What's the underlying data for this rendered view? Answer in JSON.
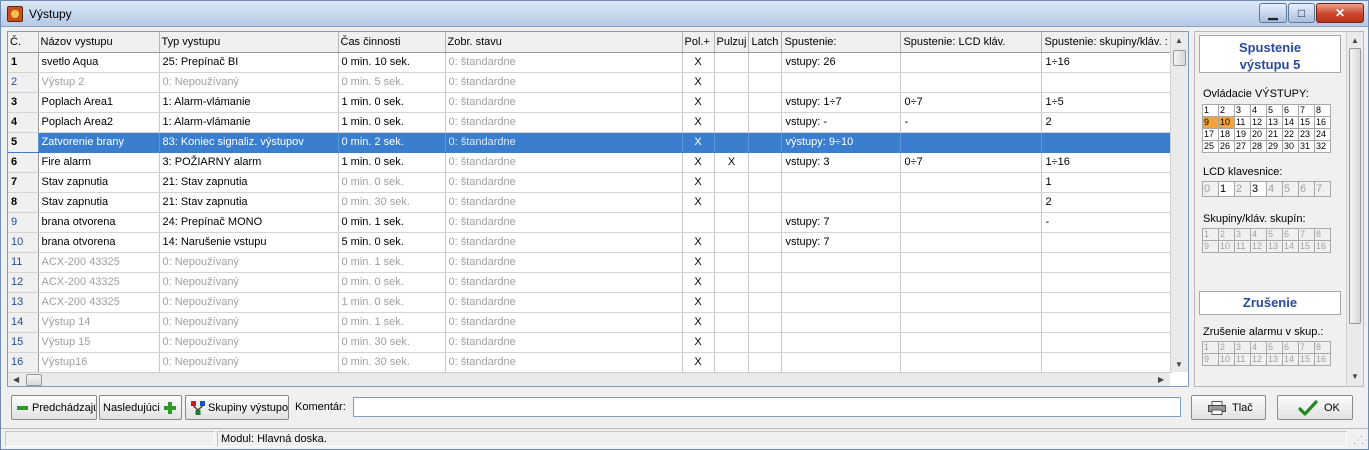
{
  "window": {
    "title": "Výstupy",
    "min_glyph": "▁",
    "max_glyph": "□",
    "close_glyph": "✕"
  },
  "table": {
    "columns": [
      "Č.",
      "Názov vystupu",
      "Typ vystupu",
      "Čas činnosti",
      "Zobr. stavu",
      "Pol.+",
      "Pulzuj",
      "Latch",
      "Spustenie:",
      "Spustenie: LCD kláv.",
      "Spustenie: skupiny/kláv. :"
    ],
    "rows": [
      {
        "num": "1",
        "name": "svetlo Aqua",
        "type": "25: Prepínač BI",
        "time": "0  min. 10  sek.",
        "state": "0: štandardne",
        "pol": "X",
        "pulz": "",
        "latch": "",
        "spust": "vstupy: 26",
        "lcd": "",
        "skup": "1÷16"
      },
      {
        "num": "2",
        "name": "Výstup   2",
        "type": "0: Nepoužívaný",
        "time": "0  min. 5  sek.",
        "state": "0: štandardne",
        "pol": "X",
        "pulz": "",
        "latch": "",
        "spust": "",
        "lcd": "",
        "skup": ""
      },
      {
        "num": "3",
        "name": "Poplach Area1",
        "type": "1: Alarm-vlámanie",
        "time": "1  min. 0  sek.",
        "state": "0: štandardne",
        "pol": "X",
        "pulz": "",
        "latch": "",
        "spust": "vstupy: 1÷7",
        "lcd": "0÷7",
        "skup": "1÷5"
      },
      {
        "num": "4",
        "name": "Poplach Area2",
        "type": "1: Alarm-vlámanie",
        "time": "1  min. 0  sek.",
        "state": "0: štandardne",
        "pol": "X",
        "pulz": "",
        "latch": "",
        "spust": "vstupy: -",
        "lcd": "-",
        "skup": "2"
      },
      {
        "num": "5",
        "name": "Zatvorenie brany",
        "type": "83: Koniec signaliz. výstupov",
        "time": "0  min. 2  sek.",
        "state": "0: štandardne",
        "pol": "X",
        "pulz": "",
        "latch": "",
        "spust": "výstupy: 9÷10",
        "lcd": "",
        "skup": ""
      },
      {
        "num": "6",
        "name": "Fire alarm",
        "type": "3: POŽIARNY alarm",
        "time": "1  min. 0  sek.",
        "state": "0: štandardne",
        "pol": "X",
        "pulz": "X",
        "latch": "",
        "spust": "vstupy: 3",
        "lcd": "0÷7",
        "skup": "1÷16"
      },
      {
        "num": "7",
        "name": "Stav zapnutia",
        "type": "21: Stav zapnutia",
        "time": "0  min. 0  sek.",
        "state": "0: štandardne",
        "pol": "X",
        "pulz": "",
        "latch": "",
        "spust": "",
        "lcd": "",
        "skup": "1"
      },
      {
        "num": "8",
        "name": "Stav zapnutia",
        "type": "21: Stav zapnutia",
        "time": "0  min. 30  sek.",
        "state": "0: štandardne",
        "pol": "X",
        "pulz": "",
        "latch": "",
        "spust": "",
        "lcd": "",
        "skup": "2"
      },
      {
        "num": "9",
        "name": "brana otvorena",
        "type": "24: Prepínač MONO",
        "time": "0  min. 1  sek.",
        "state": "0: štandardne",
        "pol": "",
        "pulz": "",
        "latch": "",
        "spust": "vstupy: 7",
        "lcd": "",
        "skup": "-"
      },
      {
        "num": "10",
        "name": "brana otvorena",
        "type": "14: Narušenie vstupu",
        "time": "5  min. 0  sek.",
        "state": "0: štandardne",
        "pol": "X",
        "pulz": "",
        "latch": "",
        "spust": "vstupy: 7",
        "lcd": "",
        "skup": ""
      },
      {
        "num": "11",
        "name": "ACX-200  43325",
        "type": "0: Nepoužívaný",
        "time": "0  min. 1  sek.",
        "state": "0: štandardne",
        "pol": "X",
        "pulz": "",
        "latch": "",
        "spust": "",
        "lcd": "",
        "skup": ""
      },
      {
        "num": "12",
        "name": "ACX-200  43325",
        "type": "0: Nepoužívaný",
        "time": "0  min. 0  sek.",
        "state": "0: štandardne",
        "pol": "X",
        "pulz": "",
        "latch": "",
        "spust": "",
        "lcd": "",
        "skup": ""
      },
      {
        "num": "13",
        "name": "ACX-200  43325",
        "type": "0: Nepoužívaný",
        "time": "1  min. 0  sek.",
        "state": "0: štandardne",
        "pol": "X",
        "pulz": "",
        "latch": "",
        "spust": "",
        "lcd": "",
        "skup": ""
      },
      {
        "num": "14",
        "name": "Výstup 14",
        "type": "0: Nepoužívaný",
        "time": "0  min. 1  sek.",
        "state": "0: štandardne",
        "pol": "X",
        "pulz": "",
        "latch": "",
        "spust": "",
        "lcd": "",
        "skup": ""
      },
      {
        "num": "15",
        "name": "Výstup 15",
        "type": "0: Nepoužívaný",
        "time": "0  min. 30  sek.",
        "state": "0: štandardne",
        "pol": "X",
        "pulz": "",
        "latch": "",
        "spust": "",
        "lcd": "",
        "skup": ""
      },
      {
        "num": "16",
        "name": "Výstup16",
        "type": "0: Nepoužívaný",
        "time": "0  min. 30  sek.",
        "state": "0: štandardne",
        "pol": "X",
        "pulz": "",
        "latch": "",
        "spust": "",
        "lcd": "",
        "skup": ""
      }
    ]
  },
  "panel": {
    "title_line1": "Spustenie",
    "title_line2": "výstupu 5",
    "ovladacie_label": "Ovládacie VÝSTUPY:",
    "ovladacie_grid": [
      [
        "1",
        "2",
        "3",
        "4",
        "5",
        "6",
        "7",
        "8"
      ],
      [
        "9",
        "10",
        "11",
        "12",
        "13",
        "14",
        "15",
        "16"
      ],
      [
        "17",
        "18",
        "19",
        "20",
        "21",
        "22",
        "23",
        "24"
      ],
      [
        "25",
        "26",
        "27",
        "28",
        "29",
        "30",
        "31",
        "32"
      ]
    ],
    "lcd_label": "LCD klavesnice:",
    "lcd_keys": [
      "0",
      "1",
      "2",
      "3",
      "4",
      "5",
      "6",
      "7"
    ],
    "skupiny_label": "Skupiny/kláv. skupín:",
    "skupiny_grid": [
      [
        "1",
        "2",
        "3",
        "4",
        "5",
        "6",
        "7",
        "8"
      ],
      [
        "9",
        "10",
        "11",
        "12",
        "13",
        "14",
        "15",
        "16"
      ]
    ],
    "zrusenie_title": "Zrušenie",
    "zrusenie_label": "Zrušenie alarmu v skup.:",
    "zrusenie_grid": [
      [
        "1",
        "2",
        "3",
        "4",
        "5",
        "6",
        "7",
        "8"
      ],
      [
        "9",
        "10",
        "11",
        "12",
        "13",
        "14",
        "15",
        "16"
      ]
    ]
  },
  "buttons": {
    "prev": "Predchádzajú",
    "next": "Nasledujúci",
    "groups": "Skupiny výstupov",
    "print": "Tlač",
    "ok": "OK"
  },
  "comment": {
    "label": "Komentár:",
    "value": ""
  },
  "status": {
    "module": "Modul: Hlavná doska."
  }
}
